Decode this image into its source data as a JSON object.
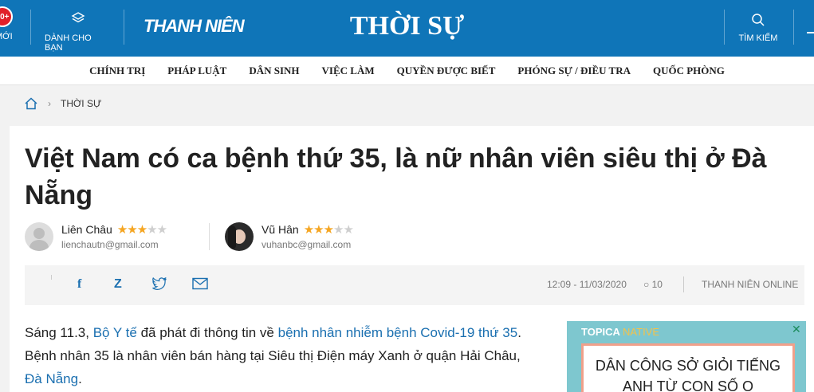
{
  "topbar": {
    "badge": "10+",
    "new_label": "MỚI",
    "for_you_label": "DÀNH CHO BẠN",
    "logo": "THANH NIÊN",
    "section": "THỜI SỰ",
    "search_label": "TÌM KIẾM",
    "brand_color": "#0f75b8"
  },
  "nav": {
    "items": [
      "CHÍNH TRỊ",
      "PHÁP LUẬT",
      "DÂN SINH",
      "VIỆC LÀM",
      "QUYỀN ĐƯỢC BIẾT",
      "PHÓNG SỰ / ĐIỀU TRA",
      "QUỐC PHÒNG"
    ]
  },
  "breadcrumb": {
    "section": "THỜI SỰ"
  },
  "article": {
    "title": "Việt Nam có ca bệnh thứ 35, là nữ nhân viên siêu thị ở Đà Nẵng",
    "authors": [
      {
        "name": "Liên Châu",
        "email": "lienchautn@gmail.com",
        "rating": 3,
        "rating_max": 5
      },
      {
        "name": "Vũ Hân",
        "email": "vuhanbc@gmail.com",
        "rating": 3,
        "rating_max": 5
      }
    ],
    "timestamp": "12:09 - 11/03/2020",
    "comments": "10",
    "source": "THANH NIÊN ONLINE",
    "body": {
      "p1": "Sáng 11.3, ",
      "l1": "Bộ Y tế",
      "p2": " đã phát đi thông tin về ",
      "l2": "bệnh nhân nhiễm bệnh Covid-19 thứ 35",
      "p3": ". Bệnh nhân 35 là nhân viên bán hàng tại Siêu thị Điện máy Xanh ở quận Hải Châu, ",
      "l3": "Đà Nẵng",
      "p4": "."
    }
  },
  "share": {
    "icons": [
      "facebook-icon",
      "zalo-icon",
      "twitter-icon",
      "email-icon"
    ]
  },
  "ad": {
    "brand": "TOPICA",
    "brand_accent": "NATIVE",
    "headline": "DÂN CÔNG SỞ GIỎI TIẾNG ANH TỪ CON SỐ O"
  }
}
